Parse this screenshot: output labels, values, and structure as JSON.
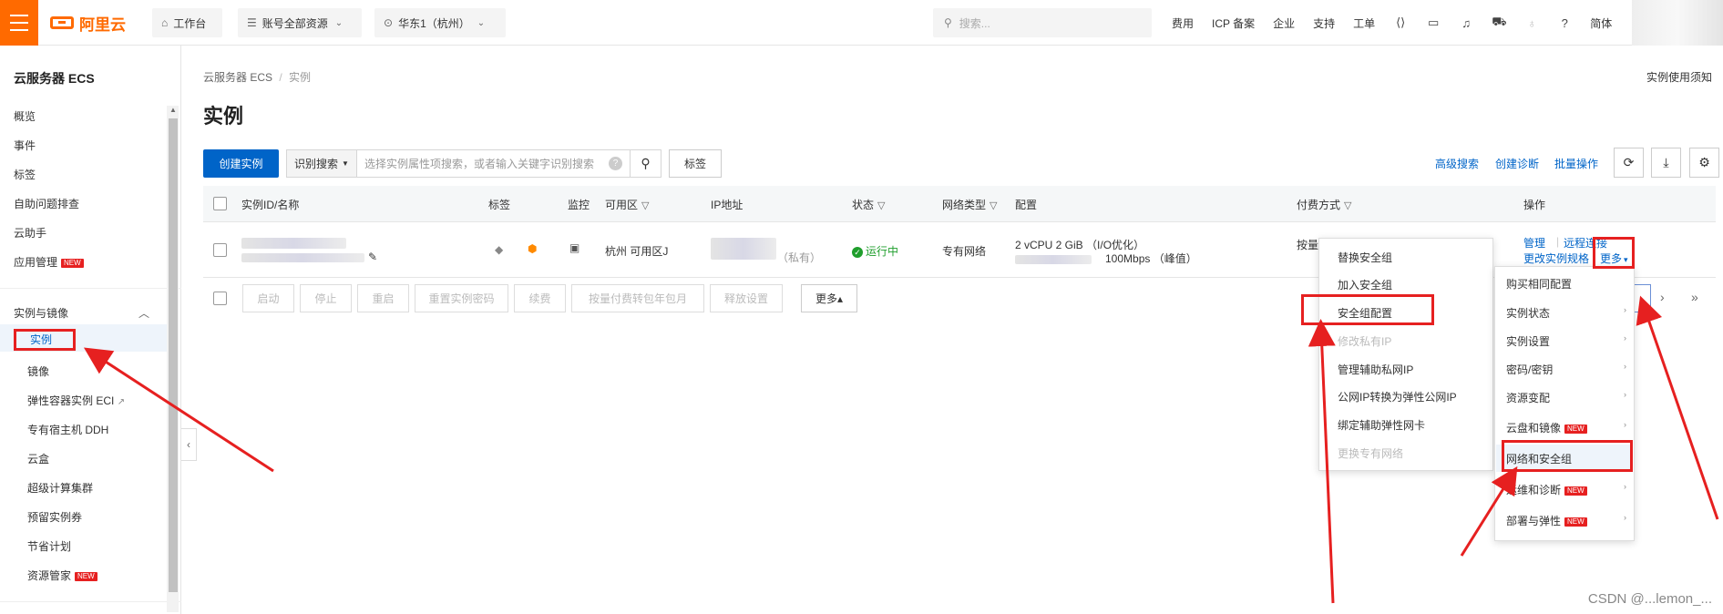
{
  "topbar": {
    "logo_text": "阿里云",
    "workbench": "工作台",
    "account_resources": "账号全部资源",
    "region": "华东1（杭州）",
    "search_placeholder": "搜索...",
    "links": [
      "费用",
      "ICP 备案",
      "企业",
      "支持",
      "工单"
    ],
    "language": "简体"
  },
  "sidebar": {
    "title": "云服务器 ECS",
    "items_top": [
      "概览",
      "事件",
      "标签",
      "自助问题排查",
      "云助手",
      "应用管理"
    ],
    "new_badge": "NEW",
    "group_label": "实例与镜像",
    "active_item": "实例",
    "sub_items": [
      "镜像",
      "弹性容器实例 ECI",
      "专有宿主机 DDH",
      "云盒",
      "超级计算集群",
      "预留实例券",
      "节省计划",
      "资源管家"
    ]
  },
  "main": {
    "breadcrumb_root": "云服务器 ECS",
    "breadcrumb_sep": "/",
    "breadcrumb_current": "实例",
    "notice_link": "实例使用须知",
    "title": "实例",
    "create_button": "创建实例",
    "search_type": "识别搜索",
    "search_placeholder": "选择实例属性项搜索，或者输入关键字识别搜索",
    "help_icon_text": "?",
    "tag_button": "标签",
    "advanced_search": "高级搜索",
    "create_diagnosis": "创建诊断",
    "batch_operation": "批量操作"
  },
  "table": {
    "headers": [
      "实例ID/名称",
      "标签",
      "监控",
      "可用区",
      "IP地址",
      "状态",
      "网络类型",
      "配置",
      "付费方式",
      "操作"
    ],
    "row": {
      "zone": "杭州 可用区J",
      "ip_suffix": "（私有）",
      "status": "运行中",
      "network": "专有网络",
      "config_line1": "2 vCPU 2 GiB （I/O优化）",
      "config_line2": "100Mbps （峰值）",
      "billing_prefix": "按量",
      "op_manage": "管理",
      "op_remote": "远程连接",
      "op_change_spec": "更改实例规格",
      "op_more": "更多"
    }
  },
  "batch_buttons": [
    "启动",
    "停止",
    "重启",
    "重置实例密码",
    "续费",
    "按量付费转包年包月",
    "释放设置",
    "更多▴"
  ],
  "dropdown_security": {
    "items": [
      "替换安全组",
      "加入安全组",
      "安全组配置",
      "修改私有IP",
      "管理辅助私网IP",
      "公网IP转换为弹性公网IP",
      "绑定辅助弹性网卡",
      "更换专有网络"
    ],
    "disabled": [
      3,
      7
    ],
    "highlighted": 2
  },
  "dropdown_more": {
    "items": [
      "购买相同配置",
      "实例状态",
      "实例设置",
      "密码/密钥",
      "资源变配",
      "云盘和镜像",
      "网络和安全组",
      "运维和诊断",
      "部署与弹性"
    ],
    "new_badges": [
      5,
      7,
      8
    ],
    "highlighted": 6
  },
  "watermark": "CSDN @...lemon_...",
  "colors": {
    "brand": "#ff6a00",
    "primary": "#0064c8",
    "annotation_red": "#e62020",
    "status_green": "#1f9e2c"
  }
}
